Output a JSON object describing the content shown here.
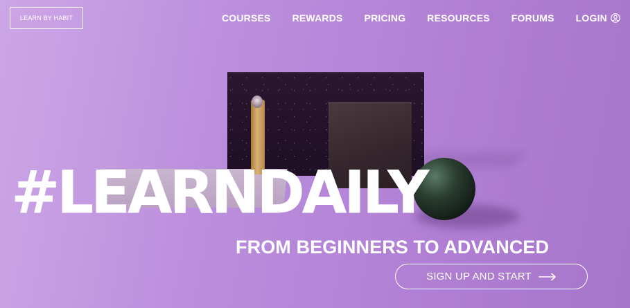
{
  "brand": {
    "logo_label": "LEARN BY HABIT"
  },
  "nav": {
    "items": [
      {
        "label": "COURSES"
      },
      {
        "label": "REWARDS"
      },
      {
        "label": "PRICING"
      },
      {
        "label": "RESOURCES"
      },
      {
        "label": "FORUMS"
      }
    ],
    "login_label": "LOGIN",
    "login_icon": "user-circle-icon"
  },
  "hero": {
    "headline": "#LEARNDAILY",
    "subheadline": "FROM BEGINNERS TO ADVANCED",
    "cta_label": "SIGN UP AND START",
    "cta_icon": "arrow-right-icon",
    "background_color": "#bb8edd"
  }
}
